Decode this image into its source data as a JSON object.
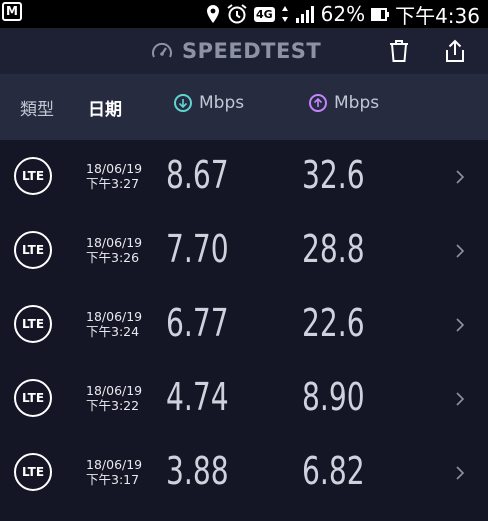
{
  "status_bar": {
    "time": "下午4:36",
    "battery": "62%",
    "network": "4G"
  },
  "header": {
    "title": "SPEEDTEST"
  },
  "columns": {
    "type": "類型",
    "date": "日期",
    "download_unit": "Mbps",
    "upload_unit": "Mbps"
  },
  "results": [
    {
      "type": "LTE",
      "date": "18/06/19",
      "time": "下午3:27",
      "download": "8.67",
      "upload": "32.6"
    },
    {
      "type": "LTE",
      "date": "18/06/19",
      "time": "下午3:26",
      "download": "7.70",
      "upload": "28.8"
    },
    {
      "type": "LTE",
      "date": "18/06/19",
      "time": "下午3:24",
      "download": "6.77",
      "upload": "22.6"
    },
    {
      "type": "LTE",
      "date": "18/06/19",
      "time": "下午3:22",
      "download": "4.74",
      "upload": "8.90"
    },
    {
      "type": "LTE",
      "date": "18/06/19",
      "time": "下午3:17",
      "download": "3.88",
      "upload": "6.82"
    }
  ],
  "colors": {
    "background": "#141626",
    "header_bg": "#1d2133",
    "column_header_bg": "#262b40",
    "download_accent": "#5fd5d0",
    "upload_accent": "#c285ff"
  }
}
